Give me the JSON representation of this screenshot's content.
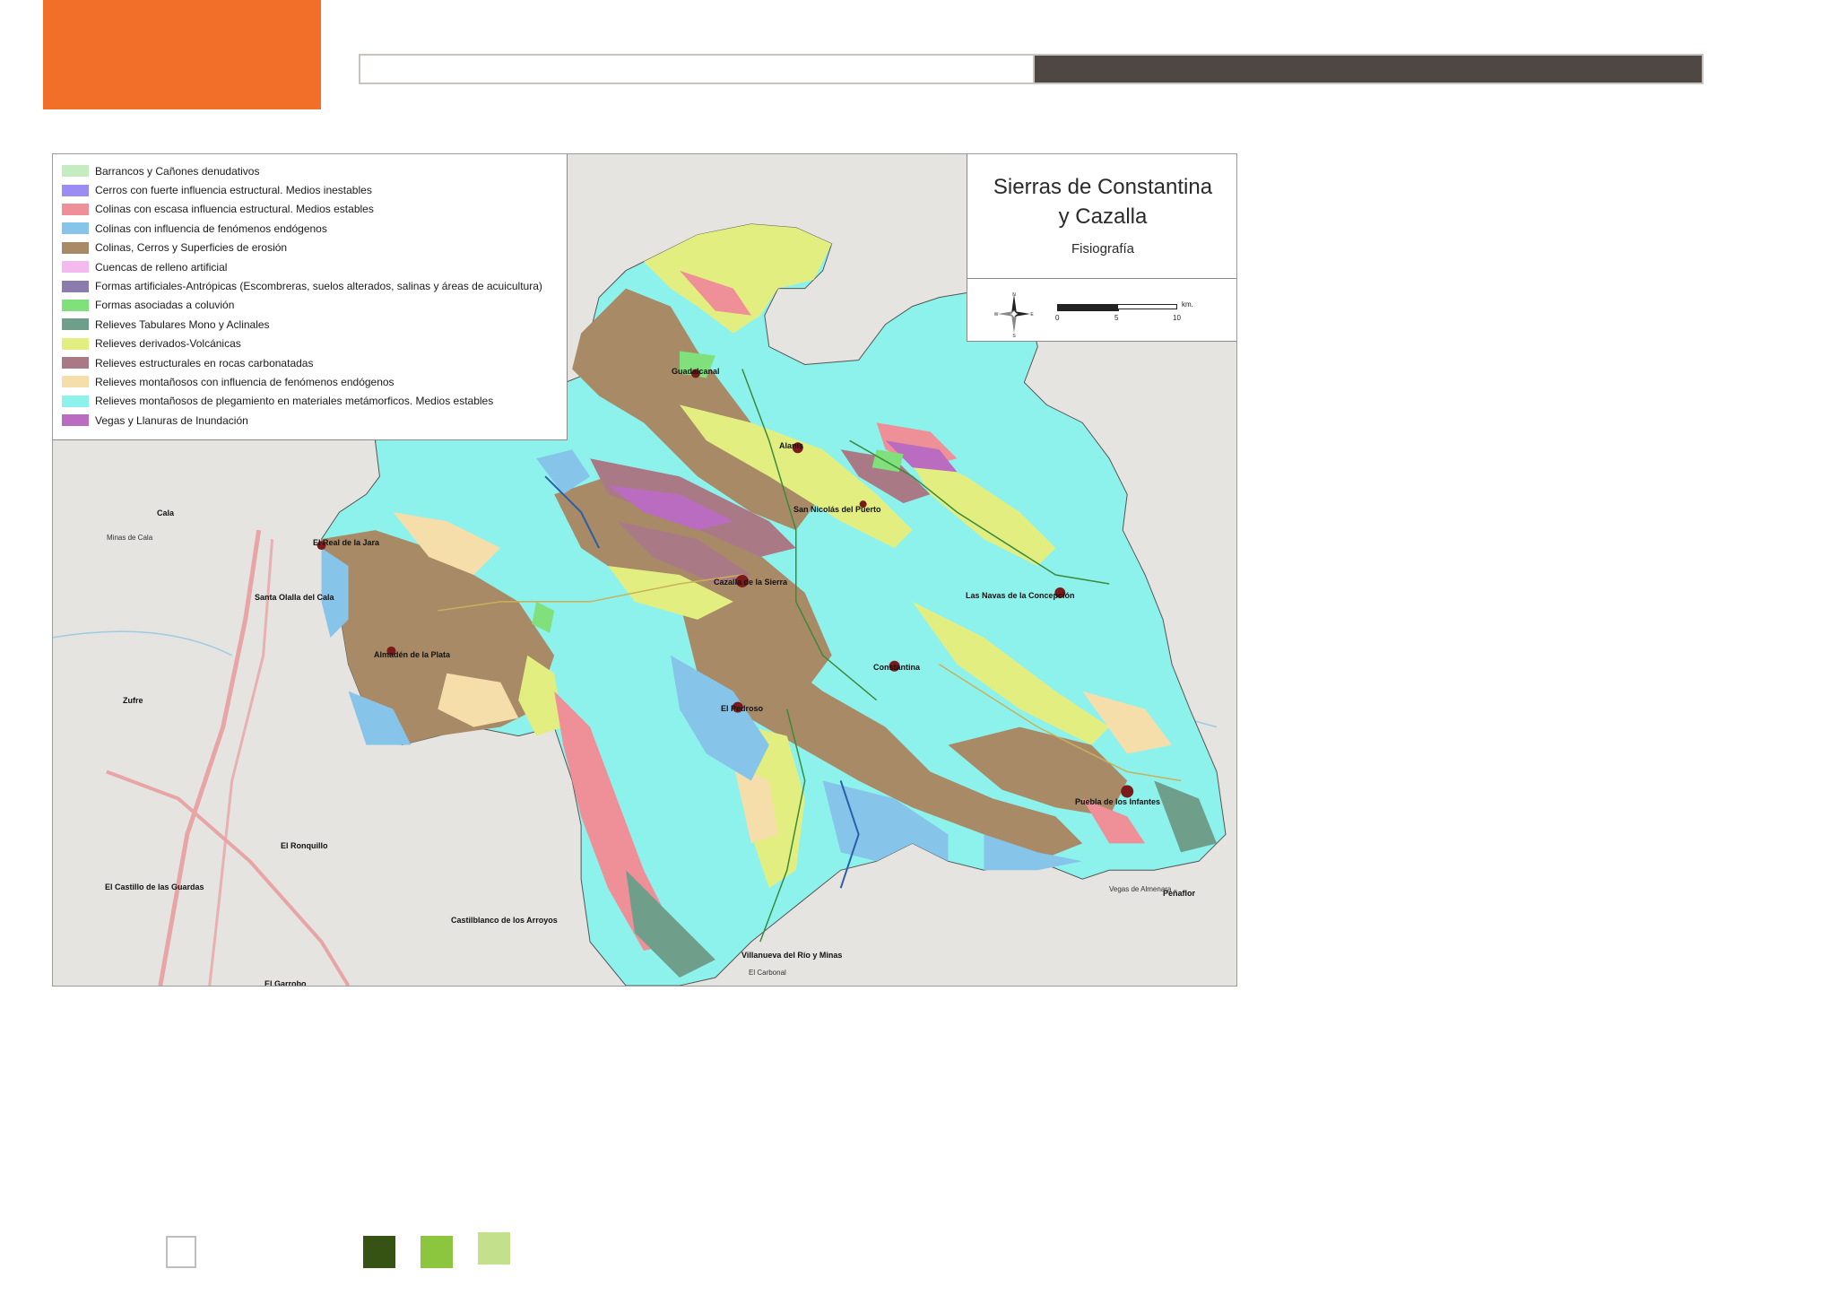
{
  "colors": {
    "orange": "#f26f2a",
    "header_dark": "#4f4743",
    "footer_squares": [
      "#ffffff",
      "#365314",
      "#8cc63e",
      "#c3e08d"
    ]
  },
  "map": {
    "title_line1": "Sierras de Constantina",
    "title_line2": "y Cazalla",
    "subtitle": "Fisiografía",
    "scale": {
      "ticks": [
        "0",
        "5",
        "10"
      ],
      "unit": "km."
    },
    "north_letters": {
      "n": "N",
      "s": "S",
      "e": "E",
      "w": "W"
    }
  },
  "legend": [
    {
      "label": "Barrancos y Cañones denudativos",
      "color": "#c3ecc0"
    },
    {
      "label": "Cerros con fuerte influencia estructural. Medios inestables",
      "color": "#9a8cf2"
    },
    {
      "label": "Colinas con escasa influencia estructural. Medios estables",
      "color": "#ef8f98"
    },
    {
      "label": "Colinas con influencia de fenómenos endógenos",
      "color": "#86c4ea"
    },
    {
      "label": "Colinas, Cerros y Superficies de erosión",
      "color": "#a98a66"
    },
    {
      "label": "Cuencas de relleno artificial",
      "color": "#f4b9ee"
    },
    {
      "label": "Formas artificiales-Antrópicas (Escombreras, suelos alterados, salinas y áreas de acuicultura)",
      "color": "#8a7dae"
    },
    {
      "label": "Formas asociadas a coluvión",
      "color": "#7fe07c"
    },
    {
      "label": "Relieves Tabulares Mono y Aclinales",
      "color": "#6f9e8a"
    },
    {
      "label": "Relieves derivados-Volcánicas",
      "color": "#e2ef80"
    },
    {
      "label": "Relieves estructurales en rocas carbonatadas",
      "color": "#a97a86"
    },
    {
      "label": "Relieves montañosos con influencia de fenómenos endógenos",
      "color": "#f6deaa"
    },
    {
      "label": "Relieves montañosos de plegamiento en materiales metámorficos. Medios estables",
      "color": "#8ef2ec"
    },
    {
      "label": "Vegas y Llanuras de Inundación",
      "color": "#b96cc0"
    }
  ],
  "places": [
    {
      "id": "alanis",
      "name": "Alanís"
    },
    {
      "id": "san-nicolas",
      "name": "San Nicolás del Puerto"
    },
    {
      "id": "cazalla",
      "name": "Cazalla de la Sierra"
    },
    {
      "id": "navas",
      "name": "Las Navas de la Concepción"
    },
    {
      "id": "constantina",
      "name": "Constantina"
    },
    {
      "id": "pedroso",
      "name": "El Pedroso"
    },
    {
      "id": "puebla",
      "name": "Puebla de los Infantes"
    },
    {
      "id": "villanueva",
      "name": "Villanueva del Río y Minas"
    },
    {
      "id": "real-jara",
      "name": "El Real de la Jara"
    },
    {
      "id": "santa-olalla",
      "name": "Santa Olalla del Cala"
    },
    {
      "id": "almaden",
      "name": "Almadén de la Plata"
    },
    {
      "id": "guadalcanal",
      "name": "Guadalcanal"
    },
    {
      "id": "cala",
      "name": "Cala"
    },
    {
      "id": "zufre",
      "name": "Zufre"
    },
    {
      "id": "ronquillo",
      "name": "El Ronquillo"
    },
    {
      "id": "castillo",
      "name": "El Castillo de las Guardas"
    },
    {
      "id": "castilblanco",
      "name": "Castilblanco de los Arroyos"
    },
    {
      "id": "garrobo",
      "name": "El Garrobo"
    },
    {
      "id": "penaflor",
      "name": "Peñaflor"
    },
    {
      "id": "vegas",
      "name": "Vegas de Almenara"
    },
    {
      "id": "carbonal",
      "name": "El Carbonal"
    },
    {
      "id": "minas-cala",
      "name": "Minas de Cala"
    }
  ]
}
